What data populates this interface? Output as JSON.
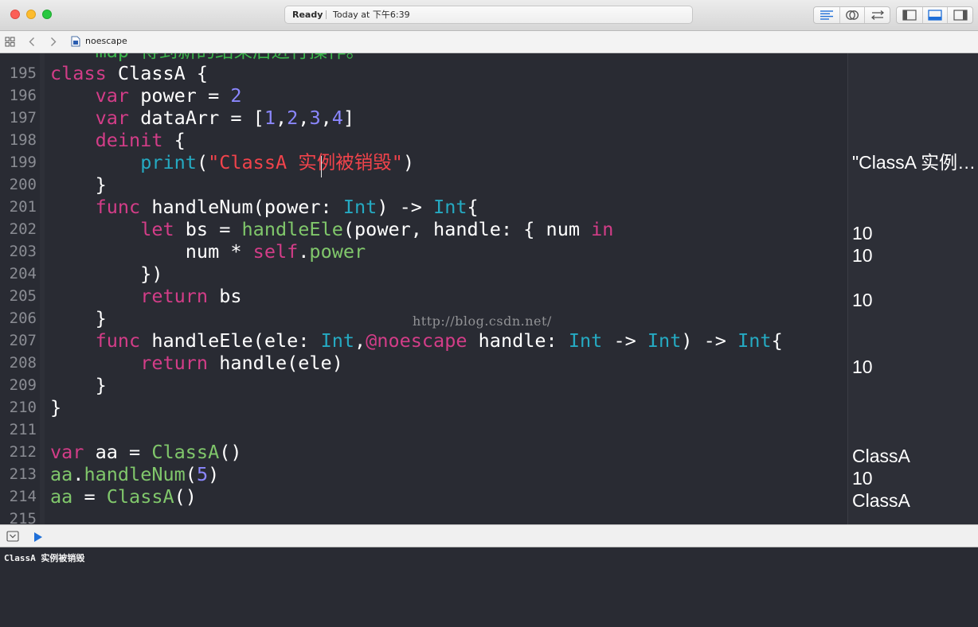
{
  "window": {
    "status": {
      "state": "Ready",
      "time": "Today at 下午6:39"
    }
  },
  "jumpbar": {
    "file": "noescape"
  },
  "editor": {
    "partial_top": [
      {
        "t": "    ",
        "c": ""
      },
      {
        "t": "map 得到新的结果后进行操作。",
        "c": "c"
      }
    ],
    "lines": [
      {
        "num": "195",
        "tokens": [
          {
            "t": "class",
            "c": "k"
          },
          {
            "t": " ClassA {",
            "c": ""
          }
        ]
      },
      {
        "num": "196",
        "tokens": [
          {
            "t": "    ",
            "c": ""
          },
          {
            "t": "var",
            "c": "k"
          },
          {
            "t": " power = ",
            "c": ""
          },
          {
            "t": "2",
            "c": "n"
          }
        ]
      },
      {
        "num": "197",
        "tokens": [
          {
            "t": "    ",
            "c": ""
          },
          {
            "t": "var",
            "c": "k"
          },
          {
            "t": " dataArr = [",
            "c": ""
          },
          {
            "t": "1",
            "c": "n"
          },
          {
            "t": ",",
            "c": ""
          },
          {
            "t": "2",
            "c": "n"
          },
          {
            "t": ",",
            "c": ""
          },
          {
            "t": "3",
            "c": "n"
          },
          {
            "t": ",",
            "c": ""
          },
          {
            "t": "4",
            "c": "n"
          },
          {
            "t": "]",
            "c": ""
          }
        ]
      },
      {
        "num": "198",
        "tokens": [
          {
            "t": "    ",
            "c": ""
          },
          {
            "t": "deinit",
            "c": "k"
          },
          {
            "t": " {",
            "c": ""
          }
        ]
      },
      {
        "num": "199",
        "tokens": [
          {
            "t": "        ",
            "c": ""
          },
          {
            "t": "print",
            "c": "t"
          },
          {
            "t": "(",
            "c": ""
          },
          {
            "t": "\"ClassA 实例被销毁\"",
            "c": "s"
          },
          {
            "t": ")",
            "c": ""
          }
        ]
      },
      {
        "num": "200",
        "tokens": [
          {
            "t": "    }",
            "c": ""
          }
        ]
      },
      {
        "num": "201",
        "tokens": [
          {
            "t": "    ",
            "c": ""
          },
          {
            "t": "func",
            "c": "k"
          },
          {
            "t": " handleNum(power: ",
            "c": ""
          },
          {
            "t": "Int",
            "c": "t"
          },
          {
            "t": ") -> ",
            "c": ""
          },
          {
            "t": "Int",
            "c": "t"
          },
          {
            "t": "{",
            "c": ""
          }
        ]
      },
      {
        "num": "202",
        "tokens": [
          {
            "t": "        ",
            "c": ""
          },
          {
            "t": "let",
            "c": "k"
          },
          {
            "t": " bs = ",
            "c": ""
          },
          {
            "t": "handleEle",
            "c": "f"
          },
          {
            "t": "(power, handle: { num ",
            "c": ""
          },
          {
            "t": "in",
            "c": "k"
          }
        ]
      },
      {
        "num": "203",
        "tokens": [
          {
            "t": "            num * ",
            "c": ""
          },
          {
            "t": "self",
            "c": "k"
          },
          {
            "t": ".",
            "c": ""
          },
          {
            "t": "power",
            "c": "f"
          }
        ]
      },
      {
        "num": "204",
        "tokens": [
          {
            "t": "        })",
            "c": ""
          }
        ]
      },
      {
        "num": "205",
        "tokens": [
          {
            "t": "        ",
            "c": ""
          },
          {
            "t": "return",
            "c": "k"
          },
          {
            "t": " bs",
            "c": ""
          }
        ]
      },
      {
        "num": "206",
        "tokens": [
          {
            "t": "    }",
            "c": ""
          }
        ]
      },
      {
        "num": "207",
        "tokens": [
          {
            "t": "    ",
            "c": ""
          },
          {
            "t": "func",
            "c": "k"
          },
          {
            "t": " handleEle(ele: ",
            "c": ""
          },
          {
            "t": "Int",
            "c": "t"
          },
          {
            "t": ",",
            "c": ""
          },
          {
            "t": "@noescape",
            "c": "k"
          },
          {
            "t": " handle: ",
            "c": ""
          },
          {
            "t": "Int",
            "c": "t"
          },
          {
            "t": " -> ",
            "c": ""
          },
          {
            "t": "Int",
            "c": "t"
          },
          {
            "t": ") -> ",
            "c": ""
          },
          {
            "t": "Int",
            "c": "t"
          },
          {
            "t": "{",
            "c": ""
          }
        ]
      },
      {
        "num": "208",
        "tokens": [
          {
            "t": "        ",
            "c": ""
          },
          {
            "t": "return",
            "c": "k"
          },
          {
            "t": " handle(ele)",
            "c": ""
          }
        ]
      },
      {
        "num": "209",
        "tokens": [
          {
            "t": "    }",
            "c": ""
          }
        ]
      },
      {
        "num": "210",
        "tokens": [
          {
            "t": "}",
            "c": ""
          }
        ]
      },
      {
        "num": "211",
        "tokens": []
      },
      {
        "num": "212",
        "tokens": [
          {
            "t": "var",
            "c": "k"
          },
          {
            "t": " aa = ",
            "c": ""
          },
          {
            "t": "ClassA",
            "c": "f"
          },
          {
            "t": "()",
            "c": ""
          }
        ]
      },
      {
        "num": "213",
        "tokens": [
          {
            "t": "aa",
            "c": "f"
          },
          {
            "t": ".",
            "c": ""
          },
          {
            "t": "handleNum",
            "c": "f"
          },
          {
            "t": "(",
            "c": ""
          },
          {
            "t": "5",
            "c": "n"
          },
          {
            "t": ")",
            "c": ""
          }
        ]
      },
      {
        "num": "214",
        "tokens": [
          {
            "t": "aa",
            "c": "f"
          },
          {
            "t": " = ",
            "c": ""
          },
          {
            "t": "ClassA",
            "c": "f"
          },
          {
            "t": "()",
            "c": ""
          }
        ]
      }
    ],
    "partial_bottom_num": "215",
    "watermark": "http://blog.csdn.net/"
  },
  "results": {
    "r199": "\"ClassA 实例…",
    "r202": "10",
    "r203": "10",
    "r205": "10",
    "r208": "10",
    "r212": "ClassA",
    "r213": "10",
    "r214": "ClassA"
  },
  "console": {
    "output": "ClassA 实例被销毁"
  },
  "icons": {
    "status_bar": [
      "close",
      "minimize",
      "zoom"
    ],
    "editor_modes": [
      "standard-editor-icon",
      "assistant-editor-icon",
      "version-editor-icon"
    ],
    "views": [
      "navigator-toggle-icon",
      "debug-area-toggle-icon",
      "utilities-toggle-icon"
    ],
    "accent": "#1f6fd8"
  }
}
